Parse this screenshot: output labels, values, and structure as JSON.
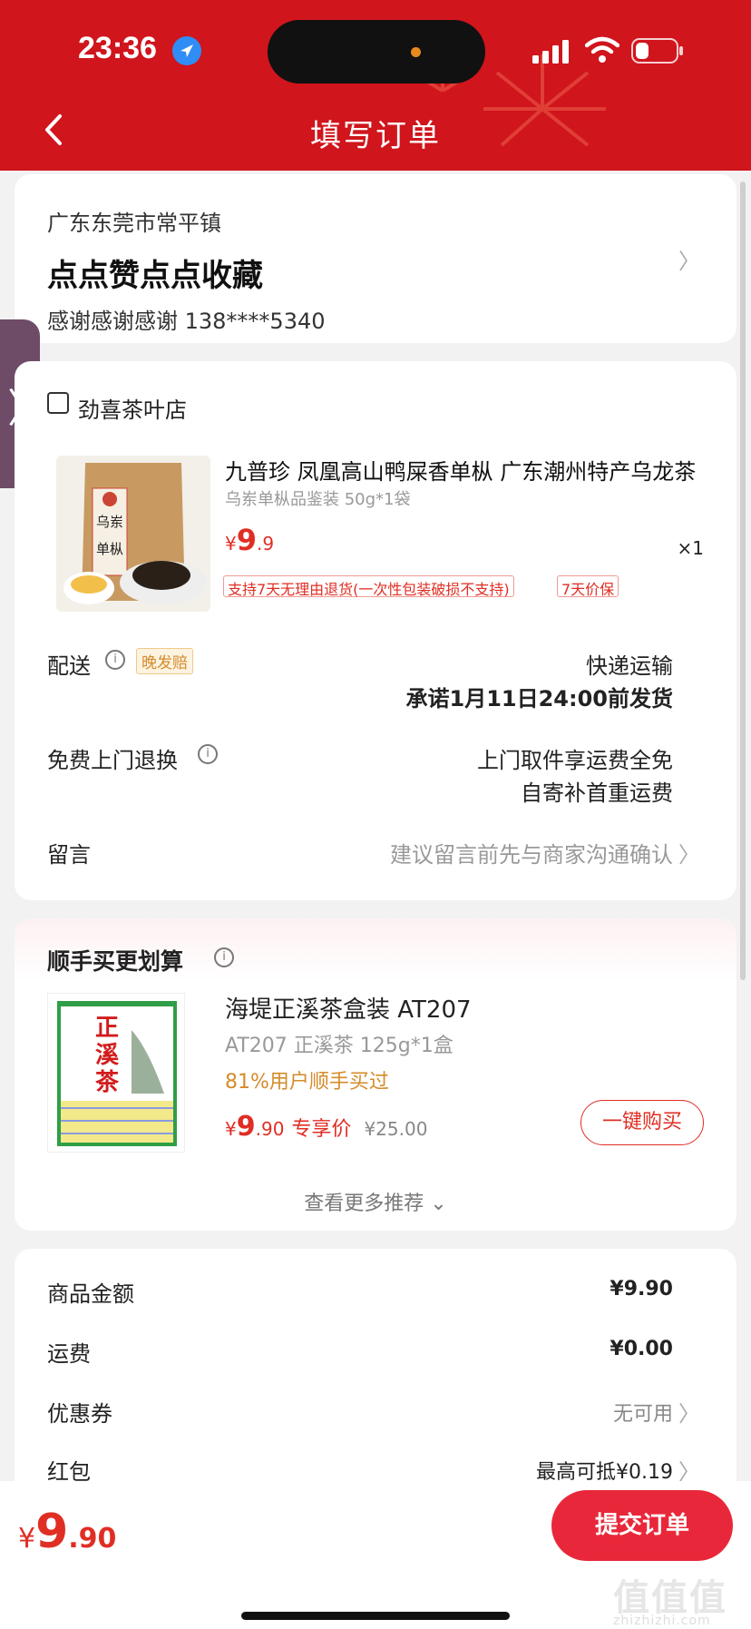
{
  "status_bar": {
    "time": "23:36"
  },
  "header": {
    "title": "填写订单"
  },
  "address": {
    "region": "广东东莞市常平镇",
    "detail": "点点赞点点收藏",
    "contact": "感谢感谢感谢  138****5340"
  },
  "shop": {
    "name": "劲喜茶叶店"
  },
  "product": {
    "title": "九普珍 凤凰高山鸭屎香单枞 广东潮州特产乌龙茶",
    "spec": "乌岽单枞品鉴装 50g*1袋",
    "price_symbol": "¥",
    "price_int": "9",
    "price_dec": ".9",
    "qty": "×1",
    "tags": [
      "支持7天无理由退货(一次性包装破损不支持)",
      "7天价保"
    ],
    "image_text": "乌岽单枞"
  },
  "delivery": {
    "label": "配送",
    "badge": "晚发赔",
    "method": "快递运输",
    "promise": "承诺1月11日24:00前发货"
  },
  "returns": {
    "label": "免费上门退换",
    "line1": "上门取件享运费全免",
    "line2": "自寄补首重运费"
  },
  "message": {
    "label": "留言",
    "placeholder": "建议留言前先与商家沟通确认"
  },
  "recommend": {
    "title": "顺手买更划算",
    "name": "海堤正溪茶盒装 AT207",
    "spec": "AT207 正溪茶 125g*1盒",
    "note": "81%用户顺手买过",
    "price_symbol": "¥",
    "price_int": "9",
    "price_dec": ".90",
    "exclusive": "专享价",
    "original": "¥25.00",
    "buy_label": "一键购买",
    "more_label": "查看更多推荐",
    "image_text": "正溪茶"
  },
  "summary": {
    "goods_label": "商品金额",
    "goods_value": "¥9.90",
    "shipping_label": "运费",
    "shipping_value": "¥0.00",
    "coupon_label": "优惠券",
    "coupon_value": "无可用",
    "redpacket_label": "红包",
    "redpacket_value": "最高可抵¥0.19"
  },
  "bottom": {
    "price_symbol": "¥",
    "price_int": "9",
    "price_dec": ".90",
    "submit_label": "提交订单",
    "watermark": "值值值",
    "watermark_url": "zhizhizhi.com"
  },
  "colors": {
    "brand_red": "#d0151c",
    "price_red": "#e02e24",
    "accent_orange": "#d58b2b"
  }
}
